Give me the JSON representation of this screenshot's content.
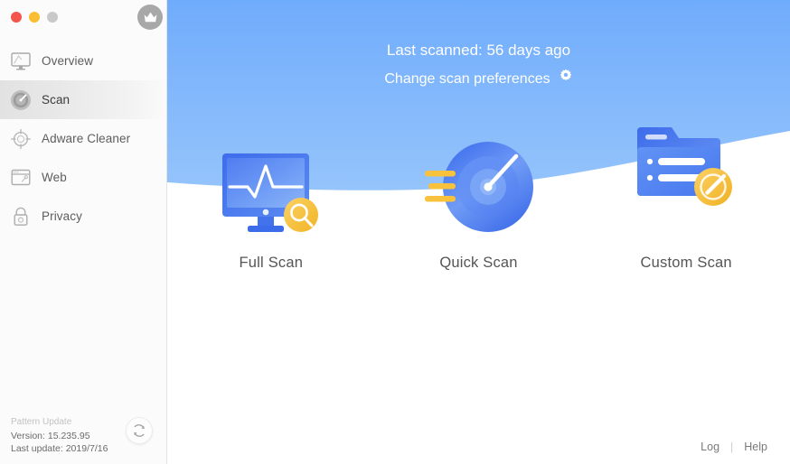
{
  "window": {
    "traffic_lights": [
      {
        "name": "close",
        "color": "#f1554c"
      },
      {
        "name": "minimize",
        "color": "#f9be32"
      },
      {
        "name": "zoom",
        "color": "#c9c9c9"
      }
    ],
    "brand_icon": "crown-icon"
  },
  "sidebar": {
    "items": [
      {
        "label": "Overview",
        "icon": "monitor-icon",
        "selected": false
      },
      {
        "label": "Scan",
        "icon": "scan-dial-icon",
        "selected": true
      },
      {
        "label": "Adware Cleaner",
        "icon": "crosshair-icon",
        "selected": false
      },
      {
        "label": "Web",
        "icon": "browser-window-icon",
        "selected": false
      },
      {
        "label": "Privacy",
        "icon": "padlock-icon",
        "selected": false
      }
    ],
    "footer": {
      "pattern_title": "Pattern Update",
      "version": "Version: 15.235.95",
      "last_update": "Last update: 2019/7/16",
      "refresh_icon": "refresh-icon"
    }
  },
  "main": {
    "header": {
      "last_scanned": "Last scanned: 56 days ago",
      "preferences_link": "Change scan preferences",
      "gear_icon": "gear-icon"
    },
    "scan_options": [
      {
        "label": "Full Scan",
        "icon": "monitor-pulse-icon"
      },
      {
        "label": "Quick Scan",
        "icon": "radar-gauge-icon"
      },
      {
        "label": "Custom Scan",
        "icon": "folder-list-icon"
      }
    ],
    "footer": {
      "log_label": "Log",
      "separator": "|",
      "help_label": "Help"
    }
  },
  "colors": {
    "hero_blue_top": "#73aefc",
    "hero_blue_bottom": "#93c3fb",
    "accent_yellow": "#f8c33c",
    "icon_blue": "#3b6fe0",
    "text_gray": "#555555"
  }
}
